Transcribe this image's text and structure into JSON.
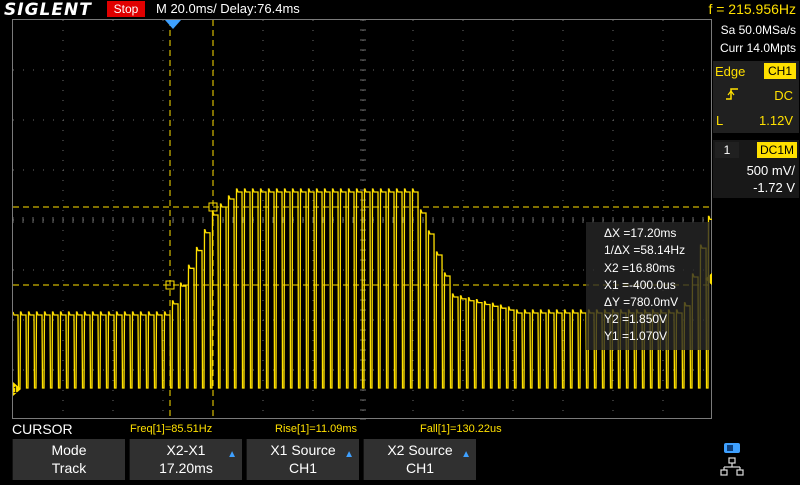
{
  "brand": "SIGLENT",
  "run_status": "Stop",
  "timebase": "M 20.0ms/ Delay:76.4ms",
  "frequency_readout": "f = 215.956Hz",
  "acquisition": {
    "sample_rate": "Sa 50.0MSa/s",
    "memory_depth": "Curr 14.0Mpts"
  },
  "trigger": {
    "mode": "Edge",
    "source": "CH1",
    "slope_icon": "rising-edge-icon",
    "coupling": "DC",
    "level_label": "L",
    "level": "1.12V"
  },
  "channel": {
    "number": "1",
    "coupling": "DC1M",
    "scale": "500 mV/",
    "offset": "-1.72 V",
    "color": "#ffe000"
  },
  "cursor_readout": {
    "dx": "ΔX =17.20ms",
    "inv_dx": "1/ΔX =58.14Hz",
    "x2": "X2 =16.80ms",
    "x1": "X1 =-400.0us",
    "dy": "ΔY =780.0mV",
    "y2": "Y2 =1.850V",
    "y1": "Y1 =1.070V"
  },
  "bottom": {
    "mode_title": "CURSOR",
    "measurements": {
      "freq": "Freq[1]=85.51Hz",
      "rise": "Rise[1]=11.09ms",
      "fall": "Fall[1]=130.22us"
    },
    "softkeys": [
      {
        "top": "Mode",
        "bottom": "Track"
      },
      {
        "top": "X2-X1",
        "bottom": "17.20ms"
      },
      {
        "top": "X1 Source",
        "bottom": "CH1"
      },
      {
        "top": "X2 Source",
        "bottom": "CH1"
      }
    ]
  },
  "markers": {
    "channel_ground_label": "1"
  },
  "colors": {
    "trace": "#ffe000",
    "accent_blue": "#3ea0ff",
    "stop_red": "#e00000"
  }
}
